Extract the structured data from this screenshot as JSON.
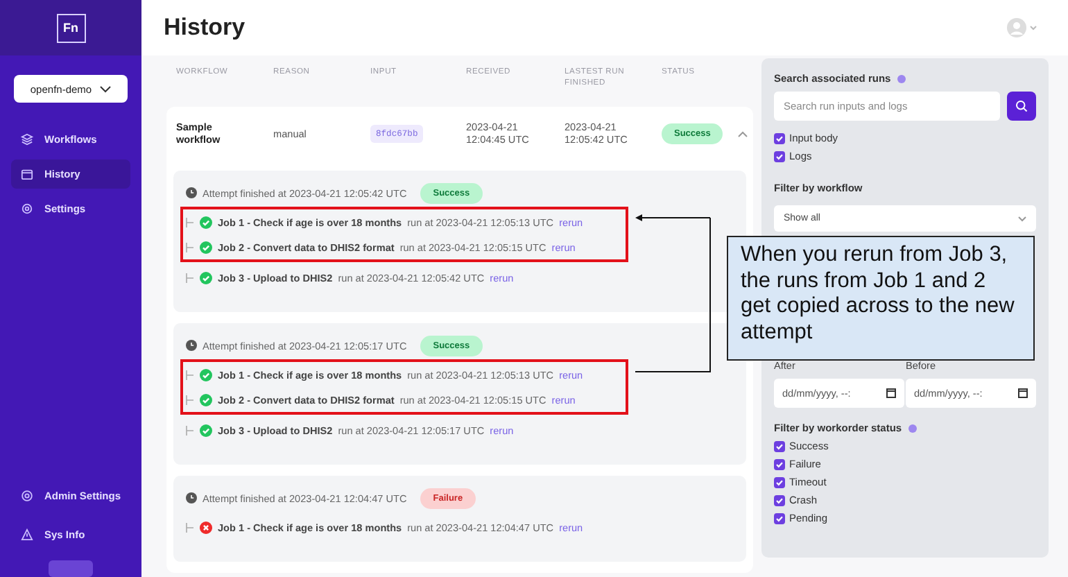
{
  "sidebar": {
    "logo": "Fn",
    "project": "openfn-demo",
    "nav": [
      {
        "label": "Workflows",
        "selected": false
      },
      {
        "label": "History",
        "selected": true
      },
      {
        "label": "Settings",
        "selected": false
      }
    ],
    "bottom": [
      {
        "label": "Admin Settings"
      },
      {
        "label": "Sys Info"
      }
    ]
  },
  "header": {
    "title": "History"
  },
  "table": {
    "columns": [
      "WORKFLOW",
      "REASON",
      "INPUT",
      "RECEIVED",
      "LASTEST RUN FINISHED",
      "STATUS"
    ],
    "work_orders": [
      {
        "workflow": "Sample workflow",
        "reason": "manual",
        "input": "8fdc67bb",
        "received": "2023-04-21 12:04:45 UTC",
        "finished": "2023-04-21 12:05:42 UTC",
        "status": "Success",
        "kind": "success",
        "expanded": true,
        "attempts": [
          {
            "title": "Attempt finished at 2023-04-21 12:05:42 UTC",
            "status": "Success",
            "kind": "success",
            "jobs": [
              {
                "name": "Job 1 - Check if age is over 18 months",
                "run_at": "run at 2023-04-21 12:05:13 UTC",
                "action": "rerun",
                "kind": "success",
                "highlighted": true
              },
              {
                "name": "Job 2 - Convert data to DHIS2 format",
                "run_at": "run at 2023-04-21 12:05:15 UTC",
                "action": "rerun",
                "kind": "success",
                "highlighted": true
              },
              {
                "name": "Job 3 - Upload to DHIS2",
                "run_at": "run at 2023-04-21 12:05:42 UTC",
                "action": "rerun",
                "kind": "success",
                "highlighted": false
              }
            ]
          },
          {
            "title": "Attempt finished at 2023-04-21 12:05:17 UTC",
            "status": "Success",
            "kind": "success",
            "jobs": [
              {
                "name": "Job 1 - Check if age is over 18 months",
                "run_at": "run at 2023-04-21 12:05:13 UTC",
                "action": "rerun",
                "kind": "success",
                "highlighted": true
              },
              {
                "name": "Job 2 - Convert data to DHIS2 format",
                "run_at": "run at 2023-04-21 12:05:15 UTC",
                "action": "rerun",
                "kind": "success",
                "highlighted": true
              },
              {
                "name": "Job 3 - Upload to DHIS2",
                "run_at": "run at 2023-04-21 12:05:17 UTC",
                "action": "rerun",
                "kind": "success",
                "highlighted": false
              }
            ]
          },
          {
            "title": "Attempt finished at 2023-04-21 12:04:47 UTC",
            "status": "Failure",
            "kind": "failure",
            "jobs": [
              {
                "name": "Job 1 - Check if age is over 18 months",
                "run_at": "run at 2023-04-21 12:04:47 UTC",
                "action": "rerun",
                "kind": "failure",
                "highlighted": false
              }
            ]
          }
        ]
      }
    ]
  },
  "filters": {
    "search_label": "Search associated runs",
    "search": {
      "placeholder": "Search run inputs and logs"
    },
    "search_options": [
      {
        "label": "Input body",
        "checked": true
      },
      {
        "label": "Logs",
        "checked": true
      }
    ],
    "workflow_label": "Filter by workflow",
    "workflow_select": "Show all",
    "date_fields": [
      {
        "label": "After",
        "placeholder": "dd/mm/yyyy, --:"
      },
      {
        "label": "Before",
        "placeholder": "dd/mm/yyyy, --:"
      }
    ],
    "status_label": "Filter by workorder status",
    "statuses": [
      {
        "label": "Success",
        "checked": true
      },
      {
        "label": "Failure",
        "checked": true
      },
      {
        "label": "Timeout",
        "checked": true
      },
      {
        "label": "Crash",
        "checked": true
      },
      {
        "label": "Pending",
        "checked": true
      }
    ]
  },
  "callout": {
    "text": "When you rerun from Job 3, the runs from Job 1 and 2 get copied across to the new attempt"
  }
}
